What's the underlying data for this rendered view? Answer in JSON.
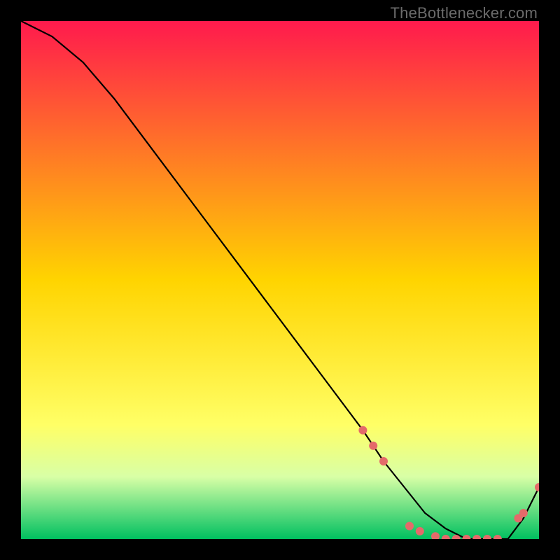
{
  "watermark": "TheBottlenecker.com",
  "colors": {
    "bg": "#000000",
    "line": "#000000",
    "marker": "#e46a6a",
    "gradient_top": "#ff1a4d",
    "gradient_mid": "#ffd400",
    "gradient_green_band_top": "#d8ffa6",
    "gradient_bottom": "#00c060"
  },
  "chart_data": {
    "type": "line",
    "title": "",
    "xlabel": "",
    "ylabel": "",
    "xlim": [
      0,
      100
    ],
    "ylim": [
      0,
      100
    ],
    "series": [
      {
        "name": "curve",
        "x": [
          0,
          6,
          12,
          18,
          24,
          30,
          36,
          42,
          48,
          54,
          60,
          66,
          70,
          74,
          78,
          82,
          86,
          90,
          94,
          97,
          100
        ],
        "y": [
          100,
          97,
          92,
          85,
          77,
          69,
          61,
          53,
          45,
          37,
          29,
          21,
          15,
          10,
          5,
          2,
          0,
          0,
          0,
          4,
          10
        ]
      }
    ],
    "markers": [
      {
        "x": 66,
        "y": 21
      },
      {
        "x": 68,
        "y": 18
      },
      {
        "x": 70,
        "y": 15
      },
      {
        "x": 75,
        "y": 2.5
      },
      {
        "x": 77,
        "y": 1.5
      },
      {
        "x": 80,
        "y": 0.5
      },
      {
        "x": 82,
        "y": 0
      },
      {
        "x": 84,
        "y": 0
      },
      {
        "x": 86,
        "y": 0
      },
      {
        "x": 88,
        "y": 0
      },
      {
        "x": 90,
        "y": 0
      },
      {
        "x": 92,
        "y": 0
      },
      {
        "x": 96,
        "y": 4
      },
      {
        "x": 97,
        "y": 5
      },
      {
        "x": 100,
        "y": 10
      }
    ]
  }
}
